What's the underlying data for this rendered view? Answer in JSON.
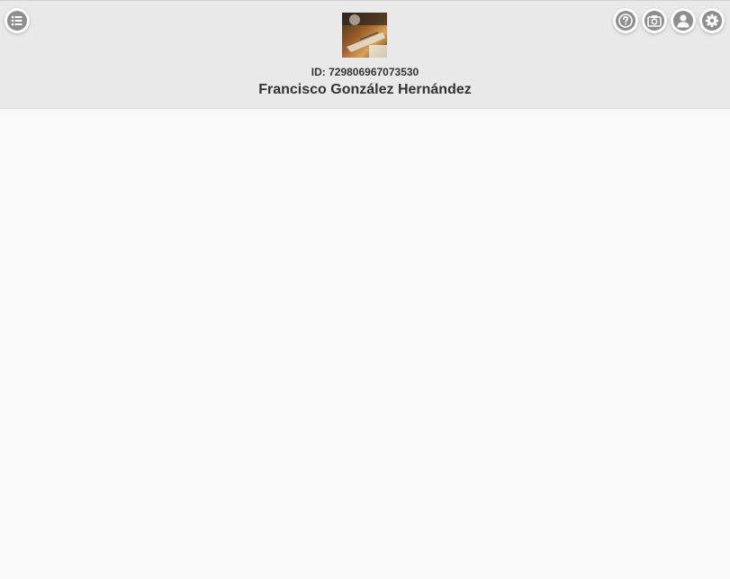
{
  "header": {
    "id_prefix": "ID: ",
    "id_value": "729806967073530",
    "name": "Francisco González Hernández"
  },
  "icons": {
    "menu": "list-icon",
    "help": "help-icon",
    "camera": "camera-icon",
    "user": "user-icon",
    "settings": "gear-icon"
  },
  "colors": {
    "header_bg": "#e9e9e9",
    "page_bg": "#f9f9f9",
    "icon_fill": "#8e8e8e",
    "text": "#333333"
  }
}
